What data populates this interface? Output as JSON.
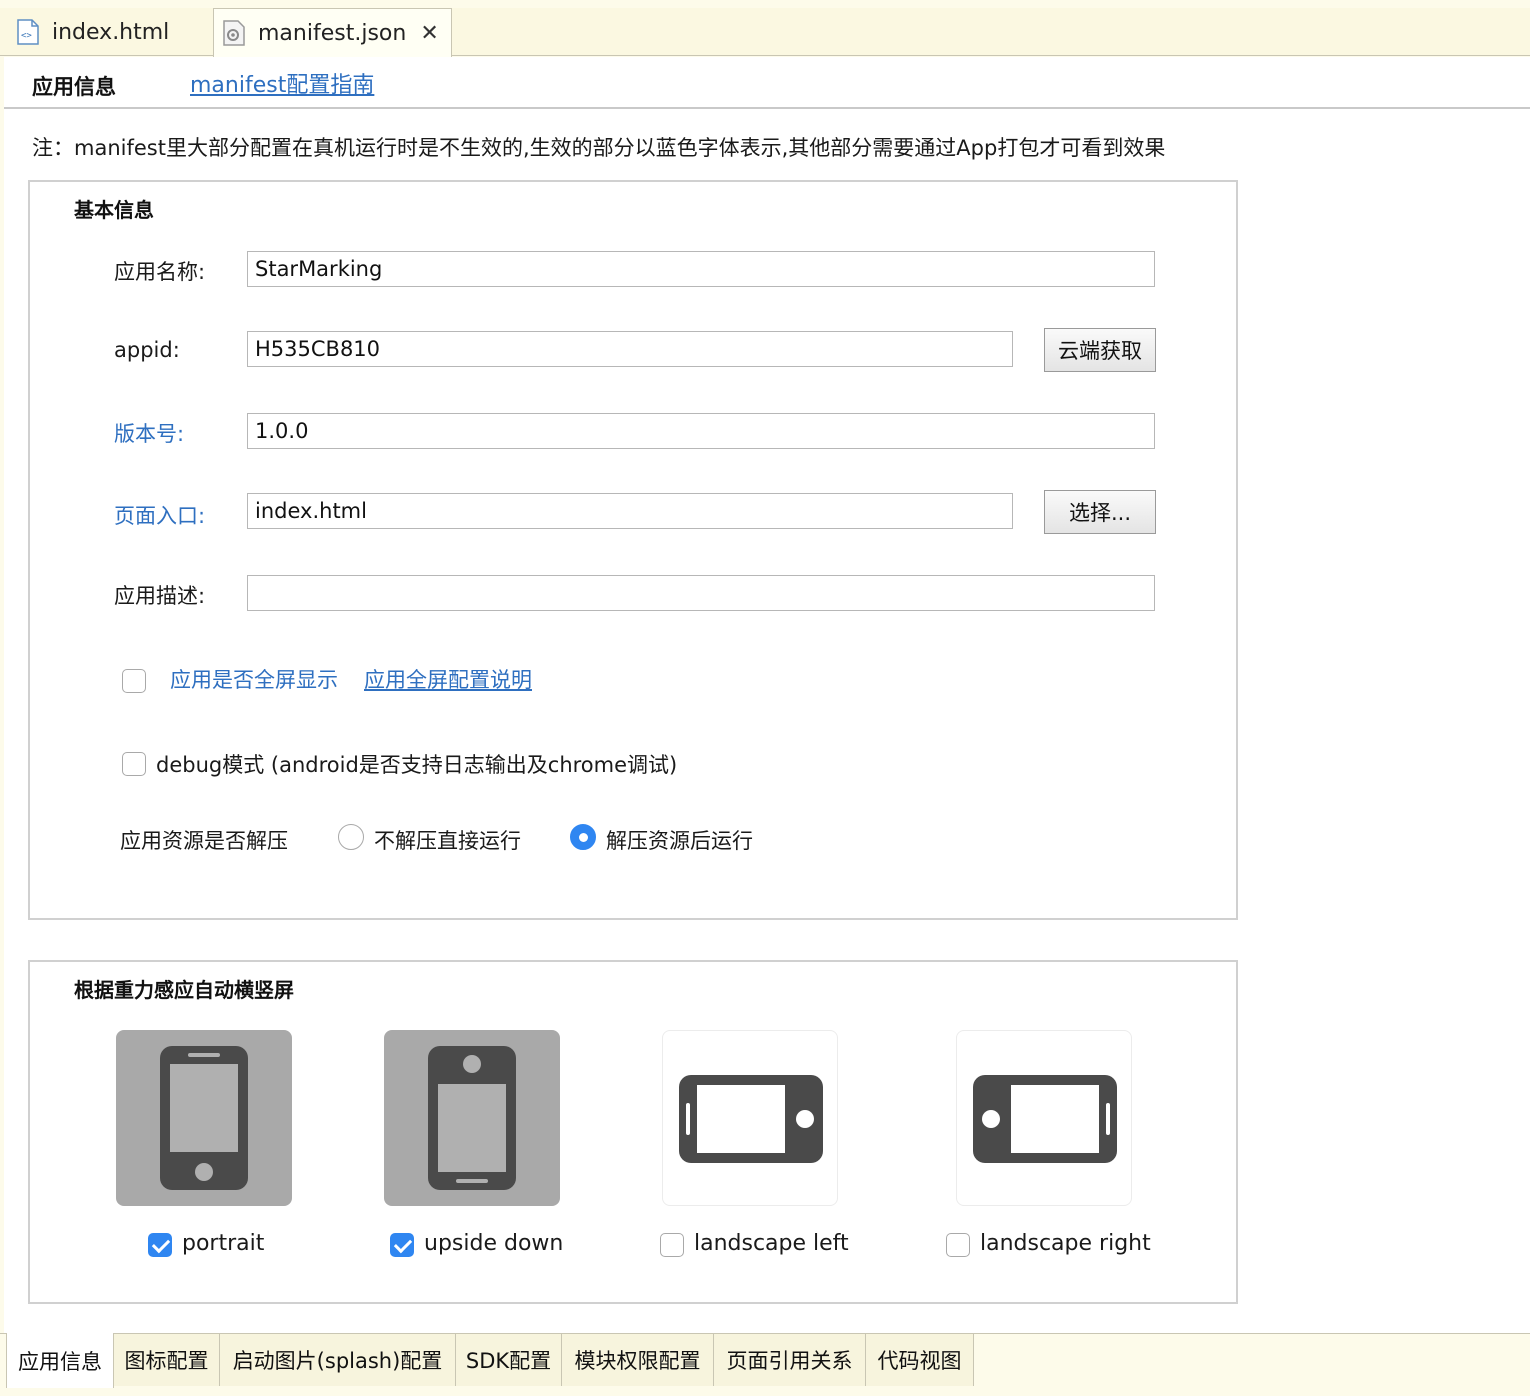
{
  "editor_tabs": [
    {
      "label": "index.html",
      "icon": "html-file-icon"
    },
    {
      "label": "manifest.json",
      "icon": "json-file-icon",
      "close_icon": "close-icon",
      "active": true
    }
  ],
  "subheader": {
    "title": "应用信息",
    "guide_link": "manifest配置指南"
  },
  "note": "注：manifest里大部分配置在真机运行时是不生效的,生效的部分以蓝色字体表示,其他部分需要通过App打包才可看到效果",
  "basic": {
    "title": "基本信息",
    "app_name": {
      "label": "应用名称:",
      "value": "StarMarking"
    },
    "appid": {
      "label": "appid:",
      "value": "H535CB810",
      "button": "云端获取"
    },
    "version": {
      "label": "版本号:",
      "value": "1.0.0"
    },
    "entry": {
      "label": "页面入口:",
      "value": "index.html",
      "button": "选择..."
    },
    "description": {
      "label": "应用描述:",
      "value": ""
    },
    "fullscreen": {
      "label": "应用是否全屏显示",
      "link": "应用全屏配置说明",
      "checked": false
    },
    "debug": {
      "label": "debug模式 (android是否支持日志输出及chrome调试)",
      "checked": false
    },
    "unzip": {
      "label": "应用资源是否解压",
      "option_direct": "不解压直接运行",
      "option_unzip": "解压资源后运行",
      "selected": "解压资源后运行"
    }
  },
  "orientation": {
    "title": "根据重力感应自动横竖屏",
    "options": [
      {
        "label": "portrait",
        "checked": true,
        "icon": "phone-portrait-icon"
      },
      {
        "label": "upside down",
        "checked": true,
        "icon": "phone-upside-down-icon"
      },
      {
        "label": "landscape left",
        "checked": false,
        "icon": "phone-landscape-left-icon"
      },
      {
        "label": "landscape right",
        "checked": false,
        "icon": "phone-landscape-right-icon"
      }
    ]
  },
  "bottom_tabs": [
    "应用信息",
    "图标配置",
    "启动图片(splash)配置",
    "SDK配置",
    "模块权限配置",
    "页面引用关系",
    "代码视图"
  ],
  "colors": {
    "link_blue": "#2e6fc0",
    "check_blue": "#2f86f1",
    "tab_bg": "#fdfbea"
  }
}
